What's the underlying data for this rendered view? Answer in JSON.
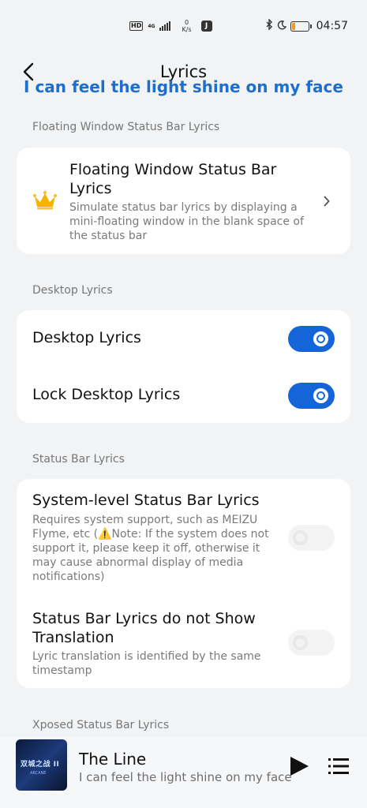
{
  "status_bar": {
    "hd": "HD",
    "network": "4G",
    "speed_value": "0",
    "speed_unit": "K/s",
    "app_badge": "J",
    "time": "04:57",
    "battery_level": 0.2
  },
  "header": {
    "title": "Lyrics",
    "floating_lyric": "I can feel the light shine on my face"
  },
  "sections": {
    "floating": {
      "label": "Floating Window Status Bar Lyrics",
      "item_title": "Floating Window Status Bar Lyrics",
      "item_desc": "Simulate status bar lyrics by displaying a mini-floating window in the blank space of the status bar"
    },
    "desktop": {
      "label": "Desktop Lyrics",
      "items": [
        {
          "title": "Desktop Lyrics",
          "enabled": true
        },
        {
          "title": "Lock Desktop Lyrics",
          "enabled": true
        }
      ]
    },
    "status_bar_lyrics": {
      "label": "Status Bar Lyrics",
      "items": [
        {
          "title": "System-level Status Bar Lyrics",
          "desc": "Requires system support, such as MEIZU Flyme, etc (⚠️Note: If the system does not support it, please keep it off, otherwise it may cause abnormal display of media notifications)",
          "enabled": false
        },
        {
          "title": "Status Bar Lyrics do not Show Translation",
          "desc": "Lyric translation is identified by the same timestamp",
          "enabled": false
        }
      ]
    },
    "xposed": {
      "label": "Xposed Status Bar Lyrics"
    }
  },
  "player": {
    "title": "The Line",
    "subtitle": "I can feel the light shine on my face",
    "album_art_text": "双城之战 II",
    "album_art_sub": "ARCANE"
  },
  "colors": {
    "accent": "#1665d8",
    "lyric_overlay": "#1e6fcc",
    "crown": "#f4b400",
    "battery": "#f29b22"
  }
}
